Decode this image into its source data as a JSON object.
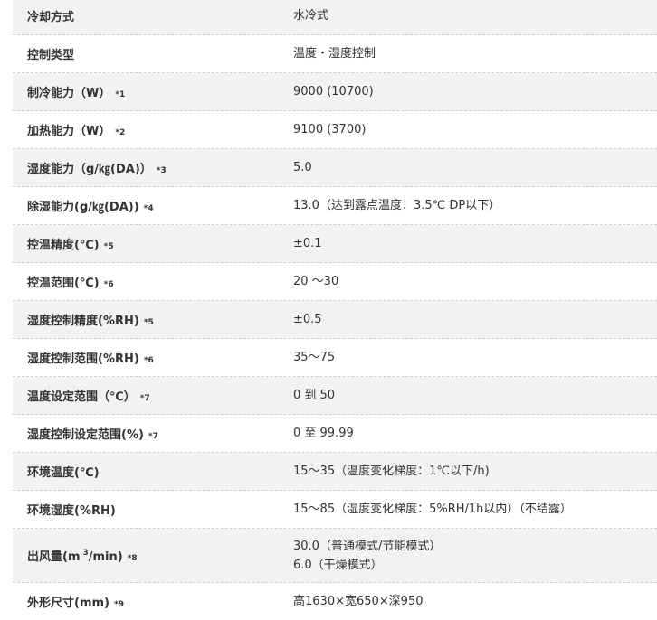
{
  "rows": [
    {
      "label": "冷却方式",
      "note": "",
      "value": "水冷式"
    },
    {
      "label": "控制类型",
      "note": "",
      "value": "温度・湿度控制"
    },
    {
      "label": "制冷能力（W）",
      "note": "*1",
      "value": "9000 (10700)"
    },
    {
      "label": "加热能力（W）",
      "note": "*2",
      "value": "9100 (3700)"
    },
    {
      "label": "湿度能力（g/㎏(DA)）",
      "note": "*3",
      "value": "5.0"
    },
    {
      "label": "除湿能力(g/㎏(DA))",
      "note": "*4",
      "value": "13.0（达到露点温度：3.5℃ DP以下）"
    },
    {
      "label": "控温精度(℃)",
      "note": "*5",
      "value": "±0.1"
    },
    {
      "label": "控温范围(℃)",
      "note": "*6",
      "value": "20 ～30"
    },
    {
      "label": "湿度控制精度(%RH)",
      "note": "*5",
      "value": "±0.5"
    },
    {
      "label": "湿度控制范围(%RH)",
      "note": "*6",
      "value": "35～75"
    },
    {
      "label": "温度设定范围（℃）",
      "note": "*7",
      "value": "0 到 50"
    },
    {
      "label": "湿度控制设定范围(%)",
      "note": "*7",
      "value": "0 至 99.99"
    },
    {
      "label": "环境温度(℃)",
      "note": "",
      "value": "15～35（温度变化梯度：1℃以下/h)"
    },
    {
      "label": "环境湿度(%RH)",
      "note": "",
      "value": "15～85（湿度变化梯度：5%RH/1h以内）（不结露）"
    }
  ],
  "airflow_row": {
    "label_prefix": "出风量(m",
    "label_sup": "3",
    "label_suffix": "/min)",
    "note": "*8",
    "value_line1": "30.0（普通模式/节能模式）",
    "value_line2": "6.0（干燥模式）"
  },
  "dimension_row": {
    "label": "外形尺寸(mm)",
    "note": "*9",
    "value": "高1630×宽650×深950"
  }
}
